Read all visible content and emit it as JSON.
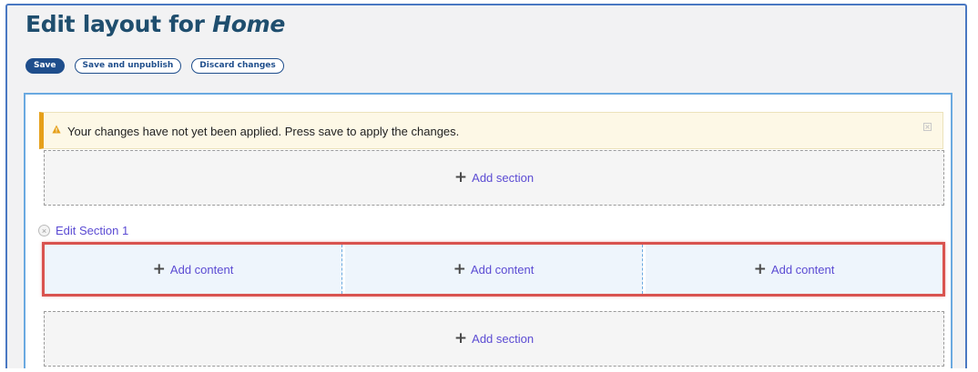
{
  "page": {
    "title_prefix": "Edit layout for ",
    "title_entity": "Home"
  },
  "actions": {
    "save": "Save",
    "save_unpublish": "Save and unpublish",
    "discard": "Discard changes"
  },
  "alert": {
    "message": "Your changes have not yet been applied. Press save to apply the changes.",
    "icon": "warning-icon",
    "color": "#e6a01a"
  },
  "add_section": {
    "plus": "+",
    "label": "Add section"
  },
  "section": {
    "edit_label": "Edit Section 1",
    "remove_icon": "×",
    "regions": [
      {
        "plus": "+",
        "label": "Add content"
      },
      {
        "plus": "+",
        "label": "Add content"
      },
      {
        "plus": "+",
        "label": "Add content"
      }
    ]
  },
  "colors": {
    "title": "#1f4e6e",
    "primary": "#1f4e8c",
    "link": "#5b4bd3",
    "highlight": "#d9534f"
  }
}
